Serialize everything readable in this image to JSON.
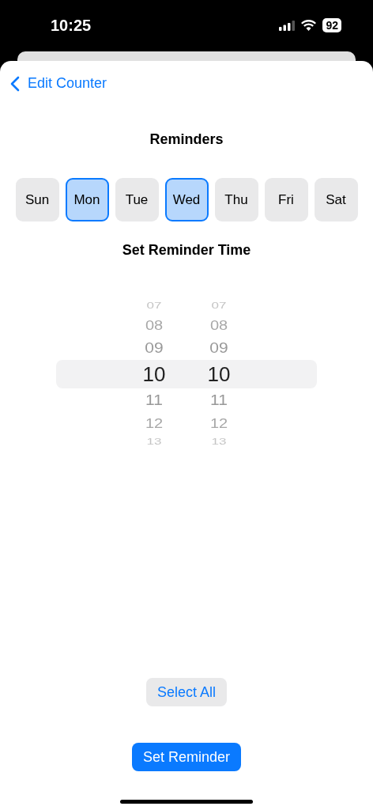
{
  "status_bar": {
    "time": "10:25",
    "battery": "92"
  },
  "nav": {
    "back_label": "Edit Counter"
  },
  "title": "Reminders",
  "days": [
    {
      "label": "Sun",
      "selected": false
    },
    {
      "label": "Mon",
      "selected": true
    },
    {
      "label": "Tue",
      "selected": false
    },
    {
      "label": "Wed",
      "selected": true
    },
    {
      "label": "Thu",
      "selected": false
    },
    {
      "label": "Fri",
      "selected": false
    },
    {
      "label": "Sat",
      "selected": false
    }
  ],
  "time_heading": "Set Reminder Time",
  "picker": {
    "columns": [
      {
        "values": [
          {
            "label": "07",
            "selected": false
          },
          {
            "label": "08",
            "selected": false
          },
          {
            "label": "09",
            "selected": false
          },
          {
            "label": "10",
            "selected": true
          },
          {
            "label": "11",
            "selected": false
          },
          {
            "label": "12",
            "selected": false
          },
          {
            "label": "13",
            "selected": false
          }
        ]
      },
      {
        "values": [
          {
            "label": "07",
            "selected": false
          },
          {
            "label": "08",
            "selected": false
          },
          {
            "label": "09",
            "selected": false
          },
          {
            "label": "10",
            "selected": true
          },
          {
            "label": "11",
            "selected": false
          },
          {
            "label": "12",
            "selected": false
          },
          {
            "label": "13",
            "selected": false
          }
        ]
      }
    ]
  },
  "buttons": [
    {
      "label": "Select All",
      "kind": "secondary"
    },
    {
      "label": "Set Reminder",
      "kind": "primary"
    }
  ]
}
